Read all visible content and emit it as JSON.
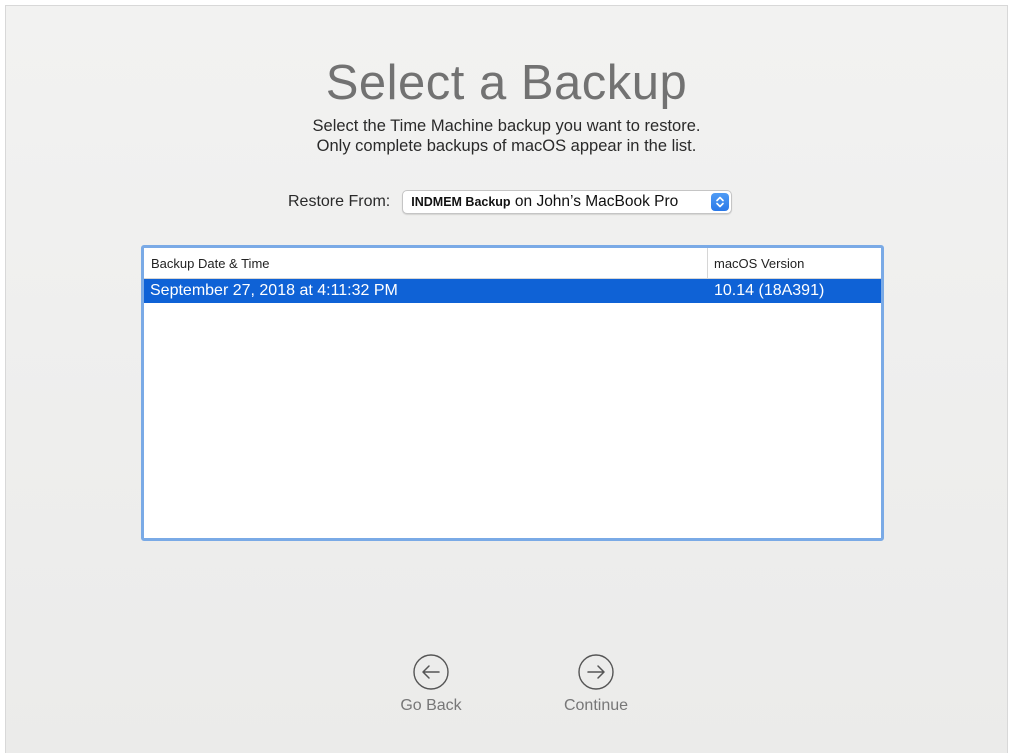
{
  "header": {
    "title": "Select a Backup",
    "subtitle_line1": "Select the Time Machine backup you want to restore.",
    "subtitle_line2": "Only complete backups of macOS appear in the list."
  },
  "restore": {
    "label": "Restore From:",
    "selected_backup_name": "INDMEM Backup",
    "selected_location": "on John’s MacBook Pro",
    "stepper_icon": "up-down-chevron-icon"
  },
  "table": {
    "columns": [
      "Backup Date & Time",
      "macOS Version"
    ],
    "rows": [
      {
        "date": "September 27, 2018 at 4:11:32 PM",
        "version": "10.14 (18A391)",
        "selected": true
      }
    ],
    "selection_color": "#0f62d6"
  },
  "navigation": {
    "back_label": "Go Back",
    "back_icon": "arrow-left-circle-icon",
    "continue_label": "Continue",
    "continue_icon": "arrow-right-circle-icon"
  }
}
